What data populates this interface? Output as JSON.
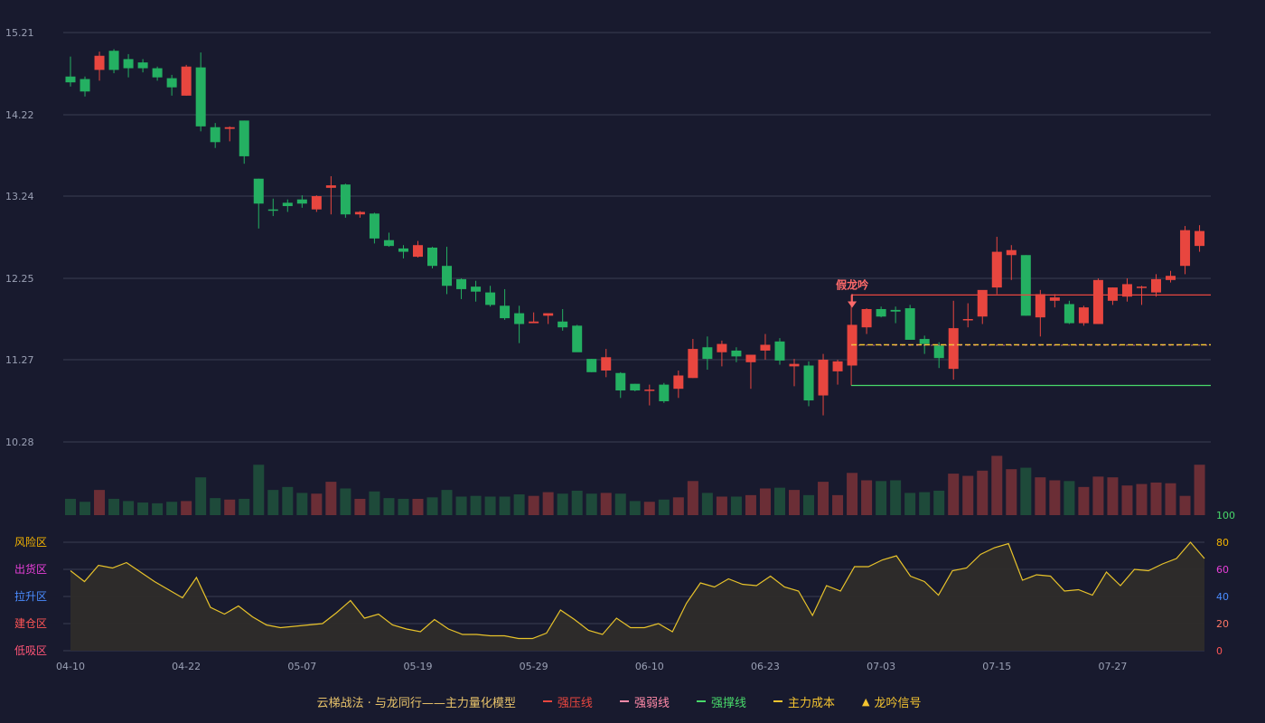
{
  "chart_data": {
    "type": "candlestick",
    "title": "云梯战法 · 与龙同行——主力量化模型",
    "price_axis": {
      "ticks": [
        10.28,
        11.27,
        12.25,
        13.24,
        14.22,
        15.21
      ],
      "range": [
        10.28,
        15.21
      ]
    },
    "x_labels": [
      {
        "index": 0,
        "label": "04-10"
      },
      {
        "index": 8,
        "label": "04-22"
      },
      {
        "index": 16,
        "label": "05-07"
      },
      {
        "index": 24,
        "label": "05-19"
      },
      {
        "index": 32,
        "label": "05-29"
      },
      {
        "index": 40,
        "label": "06-10"
      },
      {
        "index": 48,
        "label": "06-23"
      },
      {
        "index": 56,
        "label": "07-03"
      },
      {
        "index": 64,
        "label": "07-15"
      },
      {
        "index": 72,
        "label": "07-27"
      }
    ],
    "candles": [
      {
        "o": 14.68,
        "h": 14.92,
        "l": 14.56,
        "c": 14.61
      },
      {
        "o": 14.65,
        "h": 14.68,
        "l": 14.44,
        "c": 14.5
      },
      {
        "o": 14.76,
        "h": 14.98,
        "l": 14.63,
        "c": 14.93
      },
      {
        "o": 14.99,
        "h": 15.01,
        "l": 14.72,
        "c": 14.76
      },
      {
        "o": 14.89,
        "h": 14.95,
        "l": 14.67,
        "c": 14.78
      },
      {
        "o": 14.85,
        "h": 14.89,
        "l": 14.73,
        "c": 14.78
      },
      {
        "o": 14.78,
        "h": 14.8,
        "l": 14.63,
        "c": 14.67
      },
      {
        "o": 14.66,
        "h": 14.7,
        "l": 14.45,
        "c": 14.55
      },
      {
        "o": 14.45,
        "h": 14.82,
        "l": 14.45,
        "c": 14.8
      },
      {
        "o": 14.79,
        "h": 14.97,
        "l": 14.02,
        "c": 14.08
      },
      {
        "o": 14.07,
        "h": 14.12,
        "l": 13.82,
        "c": 13.89
      },
      {
        "o": 14.05,
        "h": 14.08,
        "l": 13.9,
        "c": 14.07
      },
      {
        "o": 14.15,
        "h": 14.15,
        "l": 13.63,
        "c": 13.72
      },
      {
        "o": 13.45,
        "h": 13.45,
        "l": 12.85,
        "c": 13.15
      },
      {
        "o": 13.08,
        "h": 13.21,
        "l": 13.0,
        "c": 13.07
      },
      {
        "o": 13.16,
        "h": 13.2,
        "l": 13.05,
        "c": 13.12
      },
      {
        "o": 13.2,
        "h": 13.25,
        "l": 13.1,
        "c": 13.15
      },
      {
        "o": 13.08,
        "h": 13.25,
        "l": 13.05,
        "c": 13.24
      },
      {
        "o": 13.34,
        "h": 13.48,
        "l": 13.02,
        "c": 13.37
      },
      {
        "o": 13.38,
        "h": 13.39,
        "l": 12.98,
        "c": 13.02
      },
      {
        "o": 13.02,
        "h": 13.06,
        "l": 12.98,
        "c": 13.05
      },
      {
        "o": 13.03,
        "h": 13.04,
        "l": 12.67,
        "c": 12.73
      },
      {
        "o": 12.71,
        "h": 12.8,
        "l": 12.63,
        "c": 12.64
      },
      {
        "o": 12.61,
        "h": 12.65,
        "l": 12.49,
        "c": 12.57
      },
      {
        "o": 12.51,
        "h": 12.7,
        "l": 12.5,
        "c": 12.65
      },
      {
        "o": 12.62,
        "h": 12.63,
        "l": 12.37,
        "c": 12.4
      },
      {
        "o": 12.4,
        "h": 12.63,
        "l": 12.06,
        "c": 12.16
      },
      {
        "o": 12.24,
        "h": 12.25,
        "l": 12.0,
        "c": 12.12
      },
      {
        "o": 12.15,
        "h": 12.22,
        "l": 11.97,
        "c": 12.09
      },
      {
        "o": 12.08,
        "h": 12.16,
        "l": 11.91,
        "c": 11.93
      },
      {
        "o": 11.92,
        "h": 12.12,
        "l": 11.75,
        "c": 11.77
      },
      {
        "o": 11.83,
        "h": 11.92,
        "l": 11.47,
        "c": 11.7
      },
      {
        "o": 11.71,
        "h": 11.84,
        "l": 11.72,
        "c": 11.73
      },
      {
        "o": 11.8,
        "h": 11.82,
        "l": 11.7,
        "c": 11.83
      },
      {
        "o": 11.73,
        "h": 11.88,
        "l": 11.62,
        "c": 11.66
      },
      {
        "o": 11.68,
        "h": 11.69,
        "l": 11.4,
        "c": 11.36
      },
      {
        "o": 11.28,
        "h": 11.28,
        "l": 11.12,
        "c": 11.12
      },
      {
        "o": 11.14,
        "h": 11.4,
        "l": 11.06,
        "c": 11.3
      },
      {
        "o": 11.11,
        "h": 11.12,
        "l": 10.81,
        "c": 10.9
      },
      {
        "o": 10.98,
        "h": 10.98,
        "l": 10.89,
        "c": 10.9
      },
      {
        "o": 10.9,
        "h": 10.97,
        "l": 10.72,
        "c": 10.91
      },
      {
        "o": 10.97,
        "h": 10.99,
        "l": 10.75,
        "c": 10.77
      },
      {
        "o": 10.92,
        "h": 11.14,
        "l": 10.81,
        "c": 11.08
      },
      {
        "o": 11.05,
        "h": 11.52,
        "l": 11.05,
        "c": 11.4
      },
      {
        "o": 11.42,
        "h": 11.55,
        "l": 11.15,
        "c": 11.28
      },
      {
        "o": 11.36,
        "h": 11.5,
        "l": 11.19,
        "c": 11.46
      },
      {
        "o": 11.38,
        "h": 11.42,
        "l": 11.24,
        "c": 11.31
      },
      {
        "o": 11.24,
        "h": 11.33,
        "l": 10.92,
        "c": 11.33
      },
      {
        "o": 11.38,
        "h": 11.58,
        "l": 11.27,
        "c": 11.45
      },
      {
        "o": 11.49,
        "h": 11.53,
        "l": 11.21,
        "c": 11.26
      },
      {
        "o": 11.19,
        "h": 11.28,
        "l": 10.95,
        "c": 11.22
      },
      {
        "o": 11.2,
        "h": 11.25,
        "l": 10.71,
        "c": 10.78
      },
      {
        "o": 10.84,
        "h": 11.34,
        "l": 10.6,
        "c": 11.27
      },
      {
        "o": 11.13,
        "h": 11.27,
        "l": 10.97,
        "c": 11.25
      },
      {
        "o": 11.2,
        "h": 11.69,
        "l": 11.2,
        "c": 11.69
      },
      {
        "o": 11.66,
        "h": 11.89,
        "l": 11.58,
        "c": 11.88
      },
      {
        "o": 11.88,
        "h": 11.91,
        "l": 11.78,
        "c": 11.79
      },
      {
        "o": 11.87,
        "h": 11.91,
        "l": 11.71,
        "c": 11.85
      },
      {
        "o": 11.89,
        "h": 11.93,
        "l": 11.51,
        "c": 11.51
      },
      {
        "o": 11.52,
        "h": 11.56,
        "l": 11.34,
        "c": 11.46
      },
      {
        "o": 11.44,
        "h": 11.48,
        "l": 11.17,
        "c": 11.29
      },
      {
        "o": 11.16,
        "h": 11.98,
        "l": 11.03,
        "c": 11.65
      },
      {
        "o": 11.76,
        "h": 11.95,
        "l": 11.66,
        "c": 11.76
      },
      {
        "o": 11.79,
        "h": 12.1,
        "l": 11.7,
        "c": 12.11
      },
      {
        "o": 12.14,
        "h": 12.75,
        "l": 12.06,
        "c": 12.57
      },
      {
        "o": 12.53,
        "h": 12.65,
        "l": 12.23,
        "c": 12.59
      },
      {
        "o": 12.53,
        "h": 12.53,
        "l": 11.8,
        "c": 11.8
      },
      {
        "o": 11.78,
        "h": 12.11,
        "l": 11.55,
        "c": 12.06
      },
      {
        "o": 11.98,
        "h": 12.06,
        "l": 11.9,
        "c": 12.02
      },
      {
        "o": 11.94,
        "h": 11.98,
        "l": 11.7,
        "c": 11.71
      },
      {
        "o": 11.71,
        "h": 11.92,
        "l": 11.68,
        "c": 11.9
      },
      {
        "o": 11.7,
        "h": 12.25,
        "l": 11.7,
        "c": 12.23
      },
      {
        "o": 11.98,
        "h": 12.14,
        "l": 11.93,
        "c": 12.14
      },
      {
        "o": 12.03,
        "h": 12.25,
        "l": 11.97,
        "c": 12.18
      },
      {
        "o": 12.15,
        "h": 12.16,
        "l": 11.93,
        "c": 12.15
      },
      {
        "o": 12.08,
        "h": 12.3,
        "l": 12.03,
        "c": 12.24
      },
      {
        "o": 12.23,
        "h": 12.34,
        "l": 12.2,
        "c": 12.28
      },
      {
        "o": 12.4,
        "h": 12.88,
        "l": 12.3,
        "c": 12.83
      },
      {
        "o": 12.64,
        "h": 12.89,
        "l": 12.57,
        "c": 12.82
      }
    ],
    "volumes": [
      0.22,
      0.18,
      0.34,
      0.22,
      0.19,
      0.17,
      0.16,
      0.18,
      0.19,
      0.51,
      0.23,
      0.21,
      0.22,
      0.68,
      0.34,
      0.38,
      0.3,
      0.29,
      0.45,
      0.36,
      0.22,
      0.32,
      0.23,
      0.22,
      0.22,
      0.24,
      0.34,
      0.25,
      0.26,
      0.25,
      0.25,
      0.28,
      0.26,
      0.31,
      0.29,
      0.33,
      0.29,
      0.3,
      0.29,
      0.19,
      0.18,
      0.21,
      0.24,
      0.46,
      0.3,
      0.25,
      0.25,
      0.27,
      0.36,
      0.37,
      0.34,
      0.27,
      0.45,
      0.27,
      0.57,
      0.47,
      0.46,
      0.47,
      0.3,
      0.31,
      0.33,
      0.56,
      0.53,
      0.6,
      0.8,
      0.62,
      0.64,
      0.51,
      0.47,
      0.46,
      0.38,
      0.52,
      0.51,
      0.4,
      0.42,
      0.44,
      0.43,
      0.26,
      0.68,
      0.47
    ],
    "indicator": {
      "ylim": [
        0,
        100
      ],
      "ticks": [
        0,
        20,
        40,
        60,
        80,
        100
      ],
      "zones": [
        "风险区",
        "出货区",
        "拉升区",
        "建仓区",
        "低吸区"
      ],
      "values": [
        59,
        51,
        63,
        61,
        65,
        58,
        51,
        45,
        39,
        54,
        32,
        27,
        33,
        25,
        19,
        17,
        18,
        19,
        20,
        28,
        37,
        24,
        27,
        19,
        16,
        14,
        23,
        16,
        12,
        12,
        11,
        11,
        9,
        9,
        13,
        30,
        23,
        15,
        12,
        24,
        17,
        17,
        20,
        14,
        35,
        50,
        47,
        53,
        49,
        48,
        55,
        47,
        44,
        26,
        48,
        44,
        62,
        62,
        67,
        70,
        55,
        51,
        41,
        59,
        61,
        71,
        76,
        79,
        52,
        56,
        55,
        44,
        45,
        41,
        58,
        48,
        60,
        59,
        64,
        68,
        80,
        68
      ]
    },
    "annotation": {
      "text": "假龙吟",
      "index": 54
    },
    "levels": {
      "start_index": 54,
      "strong_pressure": 12.05,
      "main_cost": 11.45,
      "strong_support": 10.96
    },
    "legend": [
      {
        "label": "强压线",
        "color": "#e8463f",
        "style": "solid"
      },
      {
        "label": "强弱线",
        "color": "#ff8aa8",
        "style": "dash"
      },
      {
        "label": "强撑线",
        "color": "#48d96a",
        "style": "solid"
      },
      {
        "label": "主力成本",
        "color": "#f4c430",
        "style": "dash"
      },
      {
        "label": "龙吟信号",
        "color": "#f4c430",
        "style": "triangle"
      }
    ],
    "colors": {
      "up": "#e8463f",
      "down": "#24b062",
      "up_vol": "#6b2e36",
      "down_vol": "#1e4a3a",
      "ind_line": "#e8c32a",
      "ind_fill": "#2e2c2a",
      "grid": "#3a3d52",
      "zone_colors": [
        "#f4b400",
        "#e83fd9",
        "#4a8cff",
        "#ff5555",
        "#ff5577"
      ]
    }
  }
}
